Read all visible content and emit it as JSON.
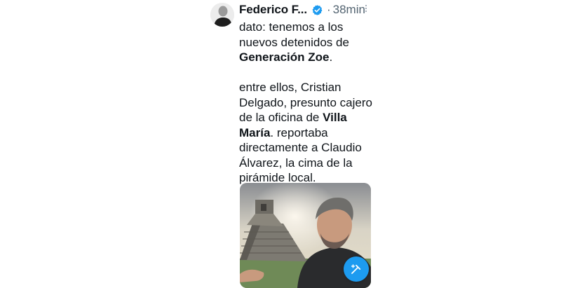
{
  "tweet": {
    "author_name": "Federico F...",
    "separator": "·",
    "time": "38min",
    "lines": [
      "dato: tenemos a los",
      "nuevos detenidos de"
    ],
    "line3_bold": "Generación Zoe",
    "line3_tail": ".",
    "para2_lines": [
      "entre ellos, Cristian",
      "Delgado, presunto cajero"
    ],
    "line_villa_pre": "de la oficina de ",
    "line_villa_bold": "Villa",
    "line_maria_bold": "María",
    "line_maria_tail": ". reportaba",
    "para2_end_lines": [
      "directamente a Claudio",
      "Álvarez, la cima de la",
      "pirámide local."
    ]
  },
  "icons": {
    "verified": "verified-badge-icon",
    "more": "more-options-icon",
    "compose": "compose-tweet-icon"
  },
  "colors": {
    "accent": "#1d9bf0",
    "muted": "#536471",
    "text": "#0f1419"
  }
}
